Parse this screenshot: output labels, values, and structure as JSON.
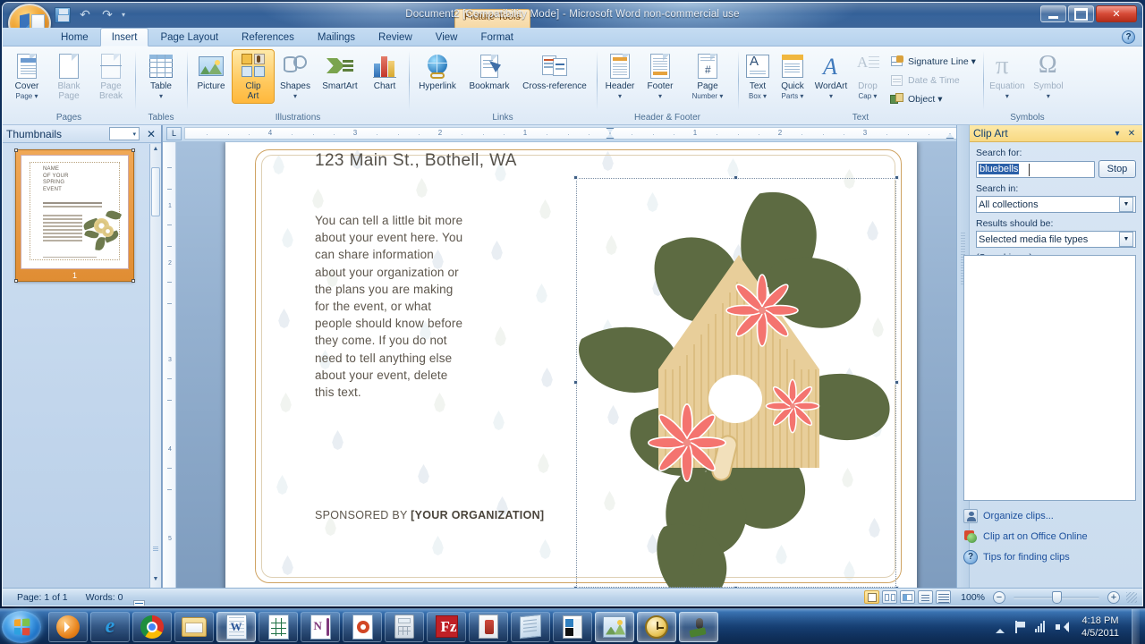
{
  "window": {
    "title": "Document2 [Compatibility Mode] - Microsoft Word non-commercial use",
    "contextual_tab_group": "Picture Tools",
    "minimize": "–",
    "maximize": "□",
    "close": "✕",
    "help": "?"
  },
  "quick_access": {
    "save": "Save",
    "undo": "Undo",
    "redo": "Redo",
    "customize": "▾"
  },
  "tabs": [
    {
      "label": "Home",
      "active": false
    },
    {
      "label": "Insert",
      "active": true
    },
    {
      "label": "Page Layout",
      "active": false
    },
    {
      "label": "References",
      "active": false
    },
    {
      "label": "Mailings",
      "active": false
    },
    {
      "label": "Review",
      "active": false
    },
    {
      "label": "View",
      "active": false
    },
    {
      "label": "Format",
      "active": false
    }
  ],
  "ribbon": {
    "groups": [
      {
        "label": "Pages",
        "buttons": [
          {
            "label_top": "Cover",
            "label_bottom": "Page ▾",
            "icon": "cover-page-icon",
            "state": "normal"
          },
          {
            "label_top": "Blank",
            "label_bottom": "Page",
            "icon": "blank-page-icon",
            "state": "normal"
          },
          {
            "label_top": "Page",
            "label_bottom": "Break",
            "icon": "page-break-icon",
            "state": "normal"
          }
        ]
      },
      {
        "label": "Tables",
        "buttons": [
          {
            "label_top": "Table",
            "label_bottom": "▾",
            "icon": "table-icon",
            "state": "normal"
          }
        ]
      },
      {
        "label": "Illustrations",
        "buttons": [
          {
            "label_top": "Picture",
            "label_bottom": "",
            "icon": "picture-icon",
            "state": "normal"
          },
          {
            "label_top": "Clip",
            "label_bottom": "Art",
            "icon": "clip-art-icon",
            "state": "selected"
          },
          {
            "label_top": "Shapes",
            "label_bottom": "▾",
            "icon": "shapes-icon",
            "state": "normal"
          },
          {
            "label_top": "SmartArt",
            "label_bottom": "",
            "icon": "smartart-icon",
            "state": "normal"
          },
          {
            "label_top": "Chart",
            "label_bottom": "",
            "icon": "chart-icon",
            "state": "normal"
          }
        ]
      },
      {
        "label": "Links",
        "buttons": [
          {
            "label_top": "Hyperlink",
            "label_bottom": "",
            "icon": "hyperlink-icon",
            "state": "normal"
          },
          {
            "label_top": "Bookmark",
            "label_bottom": "",
            "icon": "bookmark-icon",
            "state": "normal"
          },
          {
            "label_top": "Cross-reference",
            "label_bottom": "",
            "icon": "cross-reference-icon",
            "state": "normal"
          }
        ]
      },
      {
        "label": "Header & Footer",
        "buttons": [
          {
            "label_top": "Header",
            "label_bottom": "▾",
            "icon": "header-icon",
            "state": "normal"
          },
          {
            "label_top": "Footer",
            "label_bottom": "▾",
            "icon": "footer-icon",
            "state": "normal"
          },
          {
            "label_top": "Page",
            "label_bottom": "Number ▾",
            "icon": "page-number-icon",
            "state": "normal"
          }
        ]
      },
      {
        "label": "Text",
        "buttons": [
          {
            "label_top": "Text",
            "label_bottom": "Box ▾",
            "icon": "text-box-icon",
            "state": "normal"
          },
          {
            "label_top": "Quick",
            "label_bottom": "Parts ▾",
            "icon": "quick-parts-icon",
            "state": "normal"
          },
          {
            "label_top": "WordArt",
            "label_bottom": "▾",
            "icon": "wordart-icon",
            "state": "normal"
          },
          {
            "label_top": "Drop",
            "label_bottom": "Cap ▾",
            "icon": "drop-cap-icon",
            "state": "disabled"
          }
        ],
        "small_buttons": [
          {
            "label": "Signature Line ▾",
            "icon": "signature-line-icon",
            "state": "normal"
          },
          {
            "label": "Date & Time",
            "icon": "date-time-icon",
            "state": "disabled"
          },
          {
            "label": "Object ▾",
            "icon": "object-icon",
            "state": "normal"
          }
        ]
      },
      {
        "label": "Symbols",
        "buttons": [
          {
            "label_top": "Equation",
            "label_bottom": "▾",
            "icon": "equation-icon",
            "state": "disabled"
          },
          {
            "label_top": "Symbol",
            "label_bottom": "▾",
            "icon": "symbol-icon",
            "state": "normal"
          }
        ]
      }
    ]
  },
  "thumbnails_pane": {
    "title": "Thumbnails",
    "dropdown": "▾",
    "close": "✕",
    "page_number": "1",
    "preview": {
      "title_lines": [
        "NAME",
        "OF YOUR",
        "SPRING",
        "EVENT"
      ]
    }
  },
  "rulers": {
    "tab_stop": "L",
    "horizontal_left_numbers": [
      "4",
      "3",
      "2",
      "1"
    ],
    "horizontal_right_numbers": [
      "1",
      "1",
      "2",
      "3",
      "1"
    ],
    "vertical_numbers": [
      "1",
      "2",
      "3",
      "4",
      "5"
    ]
  },
  "document": {
    "address": "123 Main St., Bothell, WA",
    "body": "You can tell a little bit more about your event here. You can share information about your organization or the plans you are making for the event, or what people should know before they come. If you do not need to tell anything else about your event, delete this text.",
    "sponsor_prefix": "SPONSORED BY ",
    "sponsor_org": "[YOUR ORGANIZATION]"
  },
  "clip_art_pane": {
    "title": "Clip Art",
    "menu": "▾",
    "close": "✕",
    "search_for_label": "Search for:",
    "search_value": "bluebells",
    "stop_button": "Stop",
    "search_in_label": "Search in:",
    "search_in_value": "All collections",
    "results_label": "Results should be:",
    "results_value": "Selected media file types",
    "status": "(Searching...)",
    "links": [
      {
        "label": "Organize clips...",
        "icon": "organize-clips-icon"
      },
      {
        "label": "Clip art on Office Online",
        "icon": "office-online-icon"
      },
      {
        "label": "Tips for finding clips",
        "icon": "tips-icon"
      }
    ]
  },
  "status_bar": {
    "page": "Page: 1 of 1",
    "words": "Words: 0",
    "proofing_icon": "proofing-errors-icon",
    "views": [
      {
        "name": "print-layout-view",
        "active": true
      },
      {
        "name": "full-screen-reading-view",
        "active": false
      },
      {
        "name": "web-layout-view",
        "active": false
      },
      {
        "name": "outline-view",
        "active": false
      },
      {
        "name": "draft-view",
        "active": false
      }
    ],
    "zoom": "100%",
    "zoom_out": "−",
    "zoom_in": "+"
  },
  "taskbar": {
    "start": "Start",
    "items": [
      {
        "name": "windows-media-player",
        "state": "pinned"
      },
      {
        "name": "internet-explorer",
        "state": "pinned"
      },
      {
        "name": "google-chrome",
        "state": "pinned"
      },
      {
        "name": "windows-explorer",
        "state": "pinned"
      },
      {
        "name": "microsoft-word",
        "state": "active"
      },
      {
        "name": "microsoft-excel",
        "state": "pinned"
      },
      {
        "name": "microsoft-onenote",
        "state": "pinned"
      },
      {
        "name": "microsoft-powerpoint",
        "state": "pinned"
      },
      {
        "name": "calculator",
        "state": "pinned"
      },
      {
        "name": "filezilla",
        "state": "pinned"
      },
      {
        "name": "adobe-reader",
        "state": "pinned"
      },
      {
        "name": "notepad",
        "state": "pinned"
      },
      {
        "name": "image-editor",
        "state": "pinned"
      },
      {
        "name": "paint-window",
        "state": "active"
      },
      {
        "name": "clock-window",
        "state": "active"
      },
      {
        "name": "audio-window",
        "state": "active"
      }
    ],
    "tray": {
      "show_hidden": "▴",
      "action_center": "action-center-icon",
      "network": "network-icon",
      "volume": "volume-icon",
      "time": "4:18 PM",
      "date": "4/5/2011"
    }
  }
}
